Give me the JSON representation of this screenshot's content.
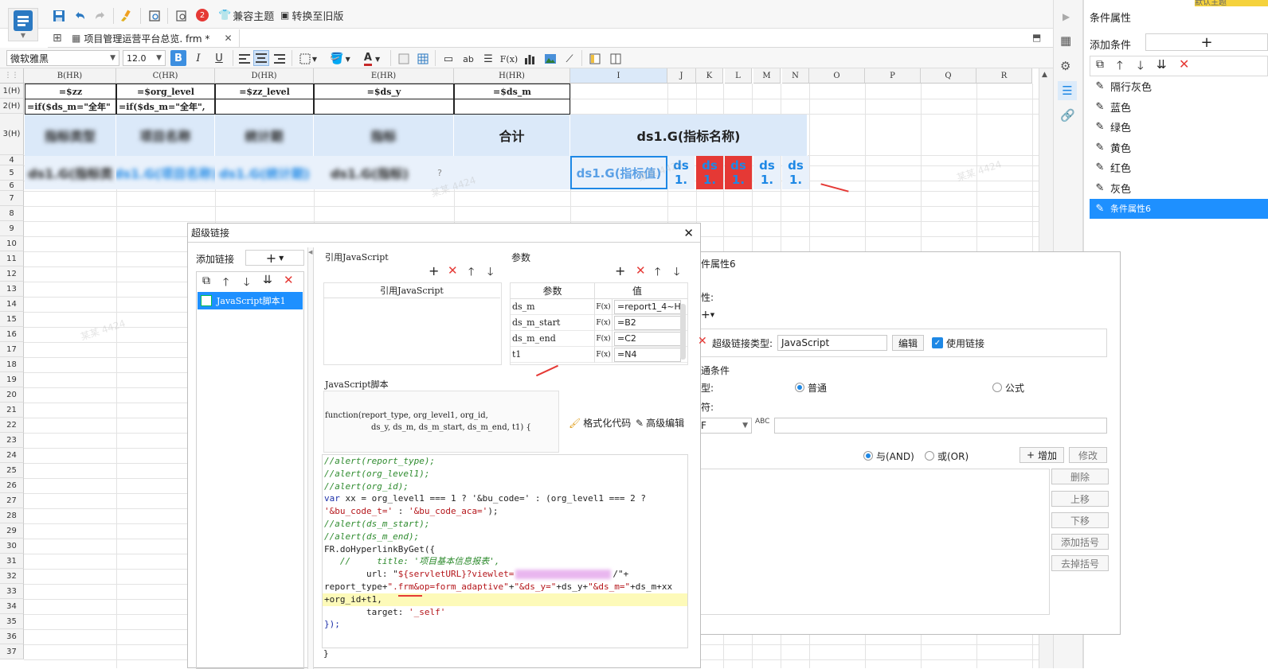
{
  "toolbar": {
    "badge": "2",
    "compat_theme": "兼容主题",
    "convert_old": "转换至旧版"
  },
  "tab": {
    "title": "项目管理运营平台总览. frm *"
  },
  "format_bar": {
    "font": "微软雅黑",
    "size": "12.0",
    "bold": "B",
    "italic": "I",
    "underline": "U",
    "text_a": "A"
  },
  "columns": [
    "B(HR)",
    "C(HR)",
    "D(HR)",
    "E(HR)",
    "H(HR)",
    "I",
    "J",
    "K",
    "L",
    "M",
    "N",
    "O",
    "P",
    "Q",
    "R"
  ],
  "rows": [
    "1(H)",
    "2(H)",
    "3(H)",
    "4",
    "5",
    "6",
    "7",
    "8",
    "9",
    "10",
    "11",
    "12",
    "13",
    "14",
    "15",
    "16",
    "17",
    "18",
    "19",
    "20",
    "21",
    "22",
    "23",
    "24",
    "25",
    "26",
    "27",
    "28",
    "29",
    "30",
    "31",
    "32",
    "33",
    "34",
    "35",
    "36",
    "37"
  ],
  "sheet": {
    "r1": [
      "=$zz",
      "=$org_level",
      "=$zz_level",
      "=$ds_y",
      "=$ds_m"
    ],
    "r2": [
      "=if($ds_m=\"全年\"",
      "=if($ds_m=\"全年\","
    ],
    "r3_b": "指标类型",
    "r3_c": "项目名称",
    "r3_d": "统计期",
    "r3_e": "指标",
    "r3_h": "合计",
    "r3_i": "ds1.G(指标名称)",
    "r4_b": "ds1.G(指标类",
    "r4_c": "ds1.G(项目名称)",
    "r4_d": "ds1.G(统计期)",
    "r4_e": "ds1.G(指标)",
    "r4_i": "ds1.G(指标值)",
    "r4_small": [
      "ds",
      "1."
    ]
  },
  "hyperlink_dialog": {
    "title": "超级链接",
    "add_link": "添加链接",
    "add_btn": "+",
    "item": "JavaScript脚本1",
    "ref_js_title": "引用JavaScript",
    "ref_js_header": "引用JavaScript",
    "params_title": "参数",
    "param_col": "参数",
    "value_col": "值",
    "params": [
      {
        "name": "ds_m",
        "fx": "F(x)",
        "value": "=report1_4~H"
      },
      {
        "name": "ds_m_start",
        "fx": "F(x)",
        "value": "=B2"
      },
      {
        "name": "ds_m_end",
        "fx": "F(x)",
        "value": "=C2"
      },
      {
        "name": "t1",
        "fx": "F(x)",
        "value": "=N4"
      }
    ],
    "js_title": "JavaScript脚本",
    "func_sig_1": "function(report_type, org_level1, org_id,",
    "func_sig_2": "ds_y, ds_m, ds_m_start, ds_m_end, t1) {",
    "format_code": "格式化代码",
    "advanced_edit": "高级编辑",
    "code_lines": [
      "//alert(report_type);",
      "//alert(org_level1);",
      "//alert(org_id);",
      "var xx = org_level1 === 1 ? '&bu_code=' : (org_level1 === 2 ?",
      "'&bu_code_t=' : '&bu_code_aca=');",
      "//alert(ds_m_start);",
      "//alert(ds_m_end);",
      "FR.doHyperlinkByGet({",
      "   //     title: '项目基本信息报表',",
      "        url: \"${servletURL}?viewlet=",
      "report_type+\".frm&op=form_adaptive\"+\"&ds_y=\"+ds_y+\"&ds_m=\"+ds_m+xx",
      "+org_id+t1,",
      "        target: '_self'",
      "});"
    ],
    "url_tail": "/\"+",
    "closing": "}"
  },
  "cond_dialog": {
    "title": "件属性6",
    "prop_label": "性:",
    "link_type_label": "超级链接类型:",
    "link_type": "JavaScript",
    "edit": "编辑",
    "use_link": "使用链接",
    "cond_title": "通条件",
    "type_label": "型:",
    "normal": "普通",
    "formula": "公式",
    "op_label": "符:",
    "op_value": "F",
    "and": "与(AND)",
    "or": "或(OR)",
    "add": "增加",
    "modify": "修改",
    "delete": "删除",
    "up": "上移",
    "down": "下移",
    "add_bracket": "添加括号",
    "remove_bracket": "去掉括号"
  },
  "right_panel": {
    "title": "条件属性",
    "add_cond": "添加条件",
    "items": [
      "隔行灰色",
      "蓝色",
      "绿色",
      "黄色",
      "红色",
      "灰色",
      "条件属性6"
    ],
    "top_tab": "默认主题"
  },
  "watermark": "某某 4424",
  "colors": {
    "accent": "#1e88e5",
    "selected": "#1e90ff",
    "red": "#e53935",
    "header_bg": "#dbe9f9",
    "highlight": "#fdfab9"
  }
}
